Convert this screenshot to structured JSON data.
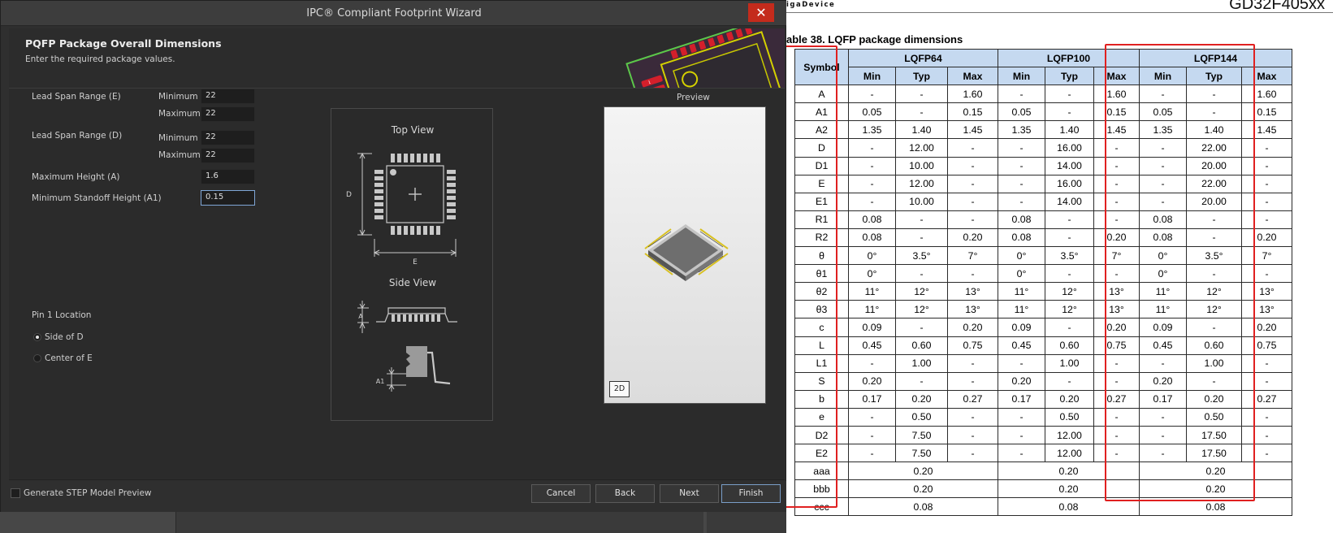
{
  "window": {
    "title": "IPC® Compliant Footprint Wizard",
    "close_glyph": "✕"
  },
  "header": {
    "title": "PQFP Package Overall Dimensions",
    "subtitle": "Enter the required package values."
  },
  "form": {
    "lead_span_e_label": "Lead Span Range (E)",
    "lead_span_d_label": "Lead Span Range (D)",
    "minimum_label": "Minimum",
    "maximum_label": "Maximum",
    "e_min": "22",
    "e_max": "22",
    "d_min": "22",
    "d_max": "22",
    "max_height_label": "Maximum Height (A)",
    "max_height": "1.6",
    "min_standoff_label": "Minimum Standoff Height (A1)",
    "min_standoff": "0.15"
  },
  "pin1": {
    "label": "Pin 1 Location",
    "options": [
      "Side of D",
      "Center of E"
    ],
    "selected": "Side of D"
  },
  "drawing": {
    "top_view": "Top View",
    "side_view": "Side View",
    "dim_d": "D",
    "dim_e": "E",
    "dim_a": "A",
    "dim_a1": "A1"
  },
  "preview": {
    "label": "Preview",
    "mode_button": "2D"
  },
  "footer": {
    "step_checkbox": "Generate STEP Model Preview",
    "step_checked": false,
    "cancel": "Cancel",
    "back": "Back",
    "next": "Next",
    "finish": "Finish"
  },
  "datasheet": {
    "brand": "igaDevice",
    "part": "GD32F405xx",
    "caption": "able 38. LQFP package dimensions",
    "symbol_header": "Symbol",
    "packages": [
      "LQFP64",
      "LQFP100",
      "LQFP144"
    ],
    "sub_headers": [
      "Min",
      "Typ",
      "Max"
    ],
    "rows": [
      [
        "A",
        "-",
        "-",
        "1.60",
        "-",
        "-",
        "1.60",
        "-",
        "-",
        "1.60"
      ],
      [
        "A1",
        "0.05",
        "-",
        "0.15",
        "0.05",
        "-",
        "0.15",
        "0.05",
        "-",
        "0.15"
      ],
      [
        "A2",
        "1.35",
        "1.40",
        "1.45",
        "1.35",
        "1.40",
        "1.45",
        "1.35",
        "1.40",
        "1.45"
      ],
      [
        "D",
        "-",
        "12.00",
        "-",
        "-",
        "16.00",
        "-",
        "-",
        "22.00",
        "-"
      ],
      [
        "D1",
        "-",
        "10.00",
        "-",
        "-",
        "14.00",
        "-",
        "-",
        "20.00",
        "-"
      ],
      [
        "E",
        "-",
        "12.00",
        "-",
        "-",
        "16.00",
        "-",
        "-",
        "22.00",
        "-"
      ],
      [
        "E1",
        "-",
        "10.00",
        "-",
        "-",
        "14.00",
        "-",
        "-",
        "20.00",
        "-"
      ],
      [
        "R1",
        "0.08",
        "-",
        "-",
        "0.08",
        "-",
        "-",
        "0.08",
        "-",
        "-"
      ],
      [
        "R2",
        "0.08",
        "-",
        "0.20",
        "0.08",
        "-",
        "0.20",
        "0.08",
        "-",
        "0.20"
      ],
      [
        "θ",
        "0°",
        "3.5°",
        "7°",
        "0°",
        "3.5°",
        "7°",
        "0°",
        "3.5°",
        "7°"
      ],
      [
        "θ1",
        "0°",
        "-",
        "-",
        "0°",
        "-",
        "-",
        "0°",
        "-",
        "-"
      ],
      [
        "θ2",
        "11°",
        "12°",
        "13°",
        "11°",
        "12°",
        "13°",
        "11°",
        "12°",
        "13°"
      ],
      [
        "θ3",
        "11°",
        "12°",
        "13°",
        "11°",
        "12°",
        "13°",
        "11°",
        "12°",
        "13°"
      ],
      [
        "c",
        "0.09",
        "-",
        "0.20",
        "0.09",
        "-",
        "0.20",
        "0.09",
        "-",
        "0.20"
      ],
      [
        "L",
        "0.45",
        "0.60",
        "0.75",
        "0.45",
        "0.60",
        "0.75",
        "0.45",
        "0.60",
        "0.75"
      ],
      [
        "L1",
        "-",
        "1.00",
        "-",
        "-",
        "1.00",
        "-",
        "-",
        "1.00",
        "-"
      ],
      [
        "S",
        "0.20",
        "-",
        "-",
        "0.20",
        "-",
        "-",
        "0.20",
        "-",
        "-"
      ],
      [
        "b",
        "0.17",
        "0.20",
        "0.27",
        "0.17",
        "0.20",
        "0.27",
        "0.17",
        "0.20",
        "0.27"
      ],
      [
        "e",
        "-",
        "0.50",
        "-",
        "-",
        "0.50",
        "-",
        "-",
        "0.50",
        "-"
      ],
      [
        "D2",
        "-",
        "7.50",
        "-",
        "-",
        "12.00",
        "-",
        "-",
        "17.50",
        "-"
      ],
      [
        "E2",
        "-",
        "7.50",
        "-",
        "-",
        "12.00",
        "-",
        "-",
        "17.50",
        "-"
      ]
    ],
    "merged_rows": [
      [
        "aaa",
        "0.20",
        "0.20",
        "0.20"
      ],
      [
        "bbb",
        "0.20",
        "0.20",
        "0.20"
      ],
      [
        "ccc",
        "0.08",
        "0.08",
        "0.08"
      ]
    ],
    "highlight_color": "#e02020",
    "header_fill": "#c5d9f0"
  },
  "colors": {
    "dialog_bg": "#2f2f2f",
    "close_red": "#c42b1c",
    "pcb_green": "#5cc74a",
    "pad_red": "#d41f2b"
  }
}
